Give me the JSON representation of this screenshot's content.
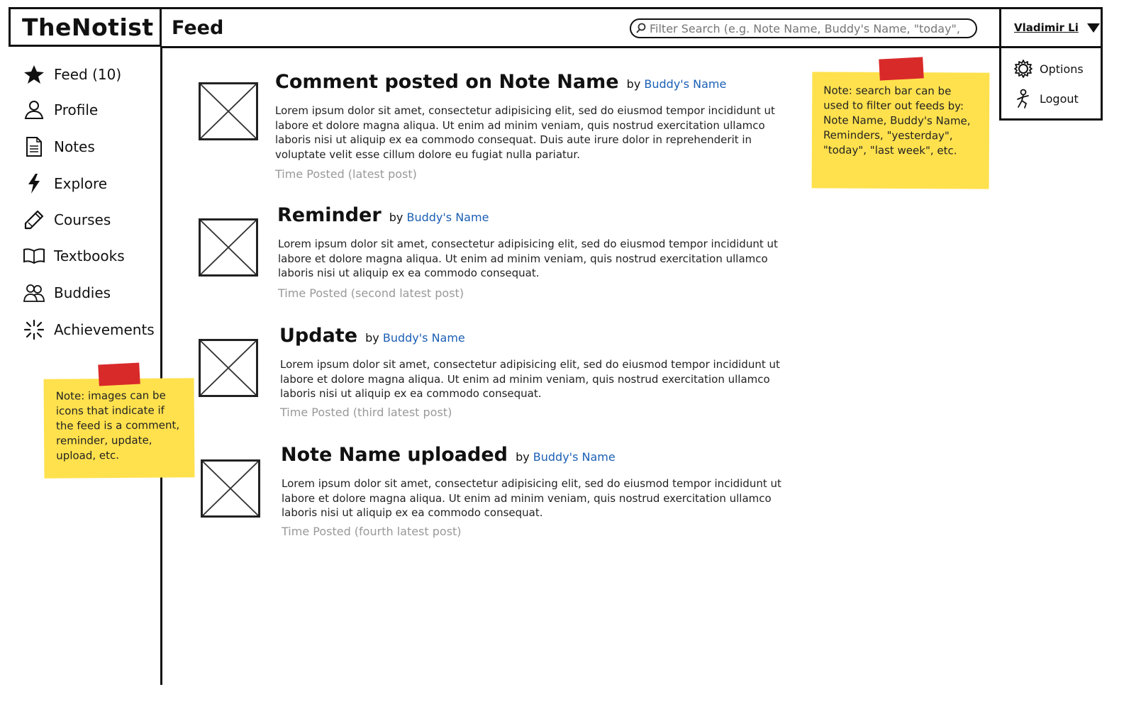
{
  "app": {
    "brand": "TheNotist"
  },
  "header": {
    "title": "Feed",
    "search_placeholder": "Filter Search (e.g. Note Name, Buddy's Name, \"today\", etc.)"
  },
  "user": {
    "name": "Vladimir Li",
    "menu": [
      {
        "label": "Options",
        "icon": "gear-icon"
      },
      {
        "label": "Logout",
        "icon": "logout-icon"
      }
    ]
  },
  "sidebar": {
    "items": [
      {
        "label": "Feed (10)",
        "icon": "star-icon"
      },
      {
        "label": "Profile",
        "icon": "user-icon"
      },
      {
        "label": "Notes",
        "icon": "document-icon"
      },
      {
        "label": "Explore",
        "icon": "lightning-icon"
      },
      {
        "label": "Courses",
        "icon": "pencil-icon"
      },
      {
        "label": "Textbooks",
        "icon": "book-icon"
      },
      {
        "label": "Buddies",
        "icon": "users-icon"
      },
      {
        "label": "Achievements",
        "icon": "sparkle-icon"
      }
    ]
  },
  "feed": [
    {
      "title": "Comment posted on Note Name",
      "by": "by",
      "buddy": "Buddy's Name",
      "body": "Lorem ipsum dolor sit amet, consectetur adipisicing elit, sed do eiusmod tempor incididunt ut labore et dolore magna aliqua. Ut enim ad minim veniam, quis nostrud exercitation ullamco laboris nisi ut aliquip ex ea commodo consequat. Duis aute irure dolor in reprehenderit in voluptate velit esse cillum dolore eu fugiat nulla pariatur.",
      "time": "Time Posted (latest post)"
    },
    {
      "title": "Reminder",
      "by": "by",
      "buddy": "Buddy's Name",
      "body": "Lorem ipsum dolor sit amet, consectetur adipisicing elit, sed do eiusmod tempor incididunt ut labore et dolore magna aliqua. Ut enim ad minim veniam, quis nostrud exercitation ullamco laboris nisi ut aliquip ex ea commodo consequat.",
      "time": "Time Posted (second latest post)"
    },
    {
      "title": "Update",
      "by": "by",
      "buddy": "Buddy's Name",
      "body": "Lorem ipsum dolor sit amet, consectetur adipisicing elit, sed do eiusmod tempor incididunt ut labore et dolore magna aliqua. Ut enim ad minim veniam, quis nostrud exercitation ullamco laboris nisi ut aliquip ex ea commodo consequat.",
      "time": "Time Posted (third latest post)"
    },
    {
      "title": "Note Name uploaded",
      "by": "by",
      "buddy": "Buddy's Name",
      "body": "Lorem ipsum dolor sit amet, consectetur adipisicing elit, sed do eiusmod tempor incididunt ut labore et dolore magna aliqua. Ut enim ad minim veniam, quis nostrud exercitation ullamco laboris nisi ut aliquip ex ea commodo consequat.",
      "time": "Time Posted (fourth latest post)"
    }
  ],
  "notes": {
    "search_note": "Note: search bar can be used to filter out feeds by: Note Name, Buddy's Name, Reminders, \"yesterday\", \"today\", \"last week\", etc.",
    "images_note": "Note: images can be icons that indicate if the feed is a comment, reminder, update, upload, etc."
  },
  "colors": {
    "link": "#1a5fb4",
    "sticky": "#ffe14d",
    "tape": "#d92a2a",
    "muted": "#999999"
  }
}
